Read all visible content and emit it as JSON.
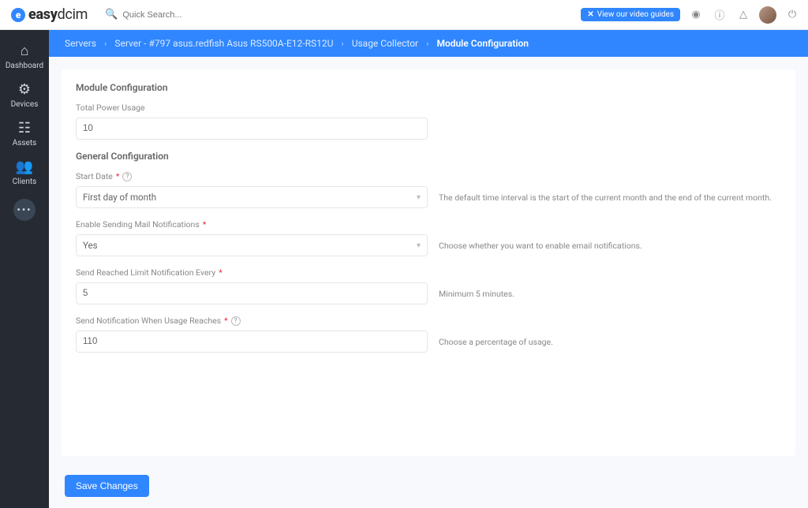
{
  "header": {
    "brand_bold": "easy",
    "brand_thin": "dcim",
    "search_placeholder": "Quick Search...",
    "promo_label": "View our video guides"
  },
  "sidebar": {
    "items": [
      {
        "icon": "⌂",
        "label": "Dashboard"
      },
      {
        "icon": "⚙",
        "label": "Devices"
      },
      {
        "icon": "☷",
        "label": "Assets"
      },
      {
        "icon": "👥",
        "label": "Clients"
      }
    ]
  },
  "crumbs": [
    "Servers",
    "Server - #797 asus.redfish Asus RS500A-E12-RS12U",
    "Usage Collector",
    "Module Configuration"
  ],
  "form": {
    "section1_title": "Module Configuration",
    "section2_title": "General Configuration",
    "total_power_label": "Total Power Usage",
    "total_power_value": "10",
    "start_date_label": "Start Date",
    "start_date_value": "First day of month",
    "start_date_hint": "The default time interval is the start of the current month and the end of the current month.",
    "enable_mail_label": "Enable Sending Mail Notifications",
    "enable_mail_value": "Yes",
    "enable_mail_hint": "Choose whether you want to enable email notifications.",
    "send_every_label": "Send Reached Limit Notification Every",
    "send_every_value": "5",
    "send_every_hint": "Minimum 5 minutes.",
    "send_when_label": "Send Notification When Usage Reaches",
    "send_when_value": "110",
    "send_when_hint": "Choose a percentage of usage."
  },
  "footer": {
    "save_label": "Save Changes"
  }
}
